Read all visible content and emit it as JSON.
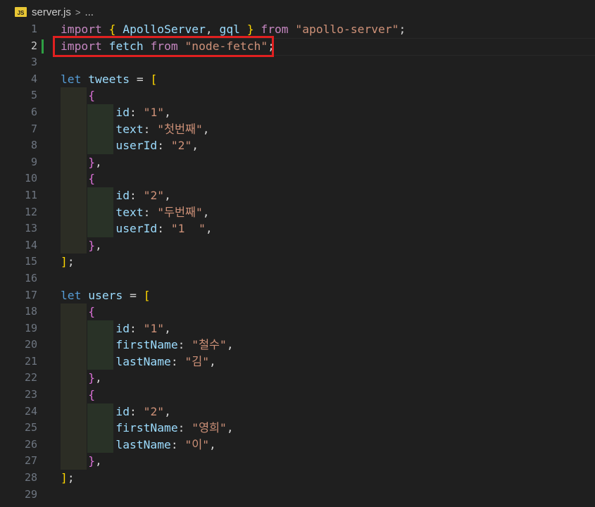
{
  "breadcrumb": {
    "icon_text": "JS",
    "file": "server.js",
    "separator": ">",
    "rest": "..."
  },
  "lines": {
    "n1": "1",
    "n2": "2",
    "n3": "3",
    "n4": "4",
    "n5": "5",
    "n6": "6",
    "n7": "7",
    "n8": "8",
    "n9": "9",
    "n10": "10",
    "n11": "11",
    "n12": "12",
    "n13": "13",
    "n14": "14",
    "n15": "15",
    "n16": "16",
    "n17": "17",
    "n18": "18",
    "n19": "19",
    "n20": "20",
    "n21": "21",
    "n22": "22",
    "n23": "23",
    "n24": "24",
    "n25": "25",
    "n26": "26",
    "n27": "27",
    "n28": "28",
    "n29": "29"
  },
  "code": {
    "kw_import": "import",
    "kw_from": "from",
    "kw_let": "let",
    "apollo_server": "ApolloServer",
    "gql": "gql",
    "apollo_module": "\"apollo-server\"",
    "fetch": "fetch",
    "node_fetch_module": "\"node-fetch\"",
    "tweets": "tweets",
    "users": "users",
    "key_id": "id",
    "key_text": "text",
    "key_userId": "userId",
    "key_firstName": "firstName",
    "key_lastName": "lastName",
    "tweet1_id": "\"1\"",
    "tweet1_text": "\"첫번째\"",
    "tweet1_userId": "\"2\"",
    "tweet2_id": "\"2\"",
    "tweet2_text": "\"두번째\"",
    "tweet2_userId": "\"1  \"",
    "user1_id": "\"1\"",
    "user1_firstName": "\"철수\"",
    "user1_lastName": "\"김\"",
    "user2_id": "\"2\"",
    "user2_firstName": "\"영희\"",
    "user2_lastName": "\"이\""
  },
  "active_line": 2,
  "colors": {
    "highlight_box": "#e02020",
    "git_added": "#2ea043"
  }
}
